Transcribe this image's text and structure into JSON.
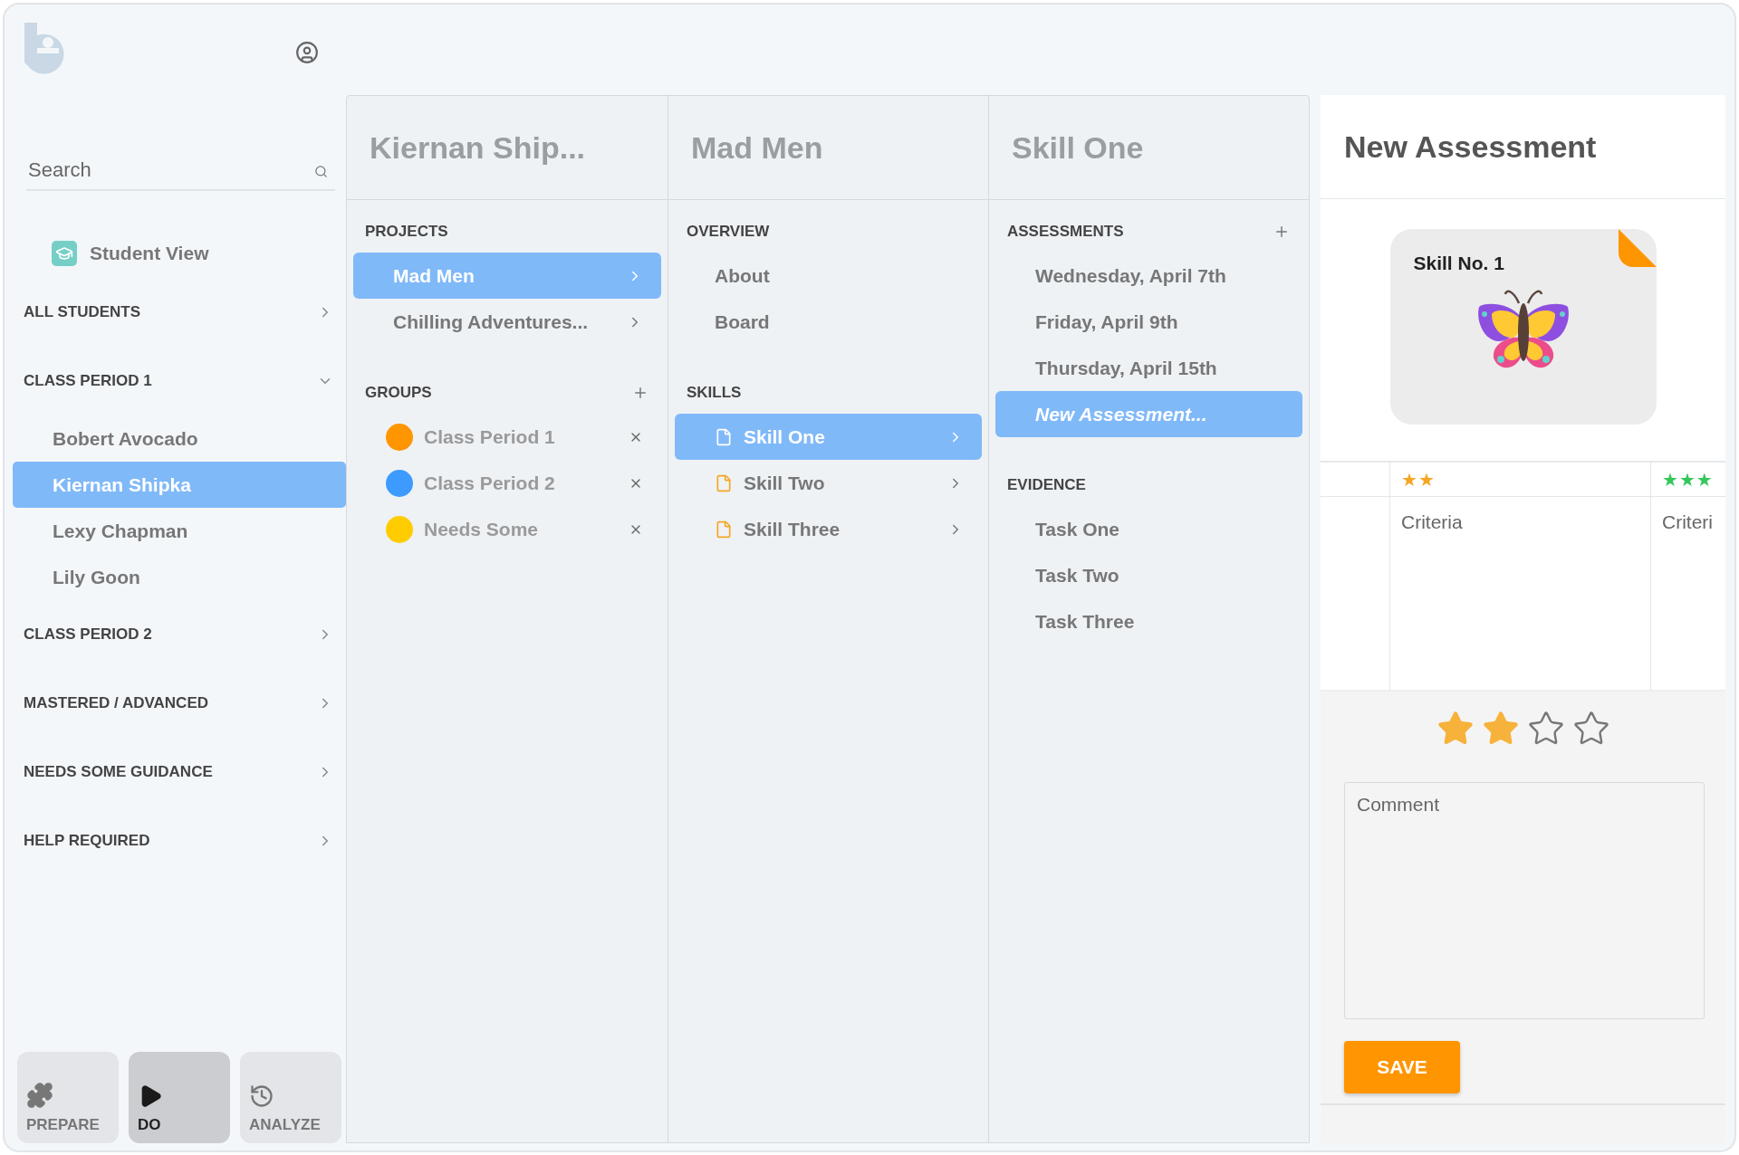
{
  "sidebar": {
    "search": {
      "placeholder": "Search"
    },
    "student_view": "Student View",
    "sections": [
      {
        "title": "ALL STUDENTS",
        "expanded": false
      },
      {
        "title": "CLASS PERIOD 1",
        "expanded": true,
        "students": [
          {
            "name": "Bobert Avocado",
            "selected": false
          },
          {
            "name": "Kiernan Shipka",
            "selected": true
          },
          {
            "name": "Lexy Chapman",
            "selected": false
          },
          {
            "name": "Lily Goon",
            "selected": false
          }
        ]
      },
      {
        "title": "CLASS PERIOD 2",
        "expanded": false
      },
      {
        "title": "MASTERED / ADVANCED",
        "expanded": false
      },
      {
        "title": "NEEDS SOME GUIDANCE",
        "expanded": false
      },
      {
        "title": "HELP REQUIRED",
        "expanded": false
      }
    ]
  },
  "modes": [
    {
      "label": "PREPARE",
      "kind": "prepare",
      "selected": false
    },
    {
      "label": "DO",
      "kind": "do",
      "selected": true
    },
    {
      "label": "ANALYZE",
      "kind": "analyze",
      "selected": false
    }
  ],
  "columns": [
    {
      "title": "Kiernan Ship...",
      "sections": [
        {
          "heading": "PROJECTS",
          "add": false,
          "items": [
            {
              "kind": "nav",
              "label": "Mad Men",
              "selected": true
            },
            {
              "kind": "nav",
              "label": "Chilling Adventures...",
              "selected": false
            }
          ]
        },
        {
          "heading": "GROUPS",
          "add": true,
          "items": [
            {
              "kind": "group",
              "label": "Class Period 1",
              "color": "#ff9500",
              "selected": false
            },
            {
              "kind": "group",
              "label": "Class Period 2",
              "color": "#3d9bff",
              "selected": false
            },
            {
              "kind": "group",
              "label": "Needs Some",
              "color": "#ffcc00",
              "selected": false
            }
          ]
        }
      ]
    },
    {
      "title": "Mad Men",
      "sections": [
        {
          "heading": "OVERVIEW",
          "add": false,
          "items": [
            {
              "kind": "plain",
              "label": "About",
              "selected": false
            },
            {
              "kind": "plain",
              "label": "Board",
              "selected": false
            }
          ]
        },
        {
          "heading": "SKILLS",
          "add": false,
          "items": [
            {
              "kind": "skill",
              "label": "Skill One",
              "selected": true
            },
            {
              "kind": "skill",
              "label": "Skill Two",
              "selected": false
            },
            {
              "kind": "skill",
              "label": "Skill Three",
              "selected": false
            }
          ]
        }
      ]
    },
    {
      "title": "Skill One",
      "sections": [
        {
          "heading": "ASSESSMENTS",
          "add": true,
          "items": [
            {
              "kind": "plain",
              "label": "Wednesday, April 7th",
              "selected": false
            },
            {
              "kind": "plain",
              "label": "Friday, April 9th",
              "selected": false
            },
            {
              "kind": "plain",
              "label": "Thursday, April 15th",
              "selected": false
            },
            {
              "kind": "draft",
              "label": "New Assessment...",
              "selected": true
            }
          ]
        },
        {
          "heading": "EVIDENCE",
          "add": false,
          "items": [
            {
              "kind": "plain",
              "label": "Task One",
              "selected": false
            },
            {
              "kind": "plain",
              "label": "Task Two",
              "selected": false
            },
            {
              "kind": "plain",
              "label": "Task Three",
              "selected": false
            }
          ]
        }
      ]
    }
  ],
  "assessment": {
    "title": "New Assessment",
    "card": {
      "title": "Skill No. 1"
    },
    "rubric": [
      {
        "level_label": "★★",
        "color": "#f5a623",
        "text": "Criteria"
      },
      {
        "level_label": "★★★",
        "color": "#34c759",
        "text": "Criteri"
      }
    ],
    "rating": {
      "stars": 2
    },
    "comment": {
      "placeholder": "Comment"
    },
    "save": "SAVE"
  }
}
